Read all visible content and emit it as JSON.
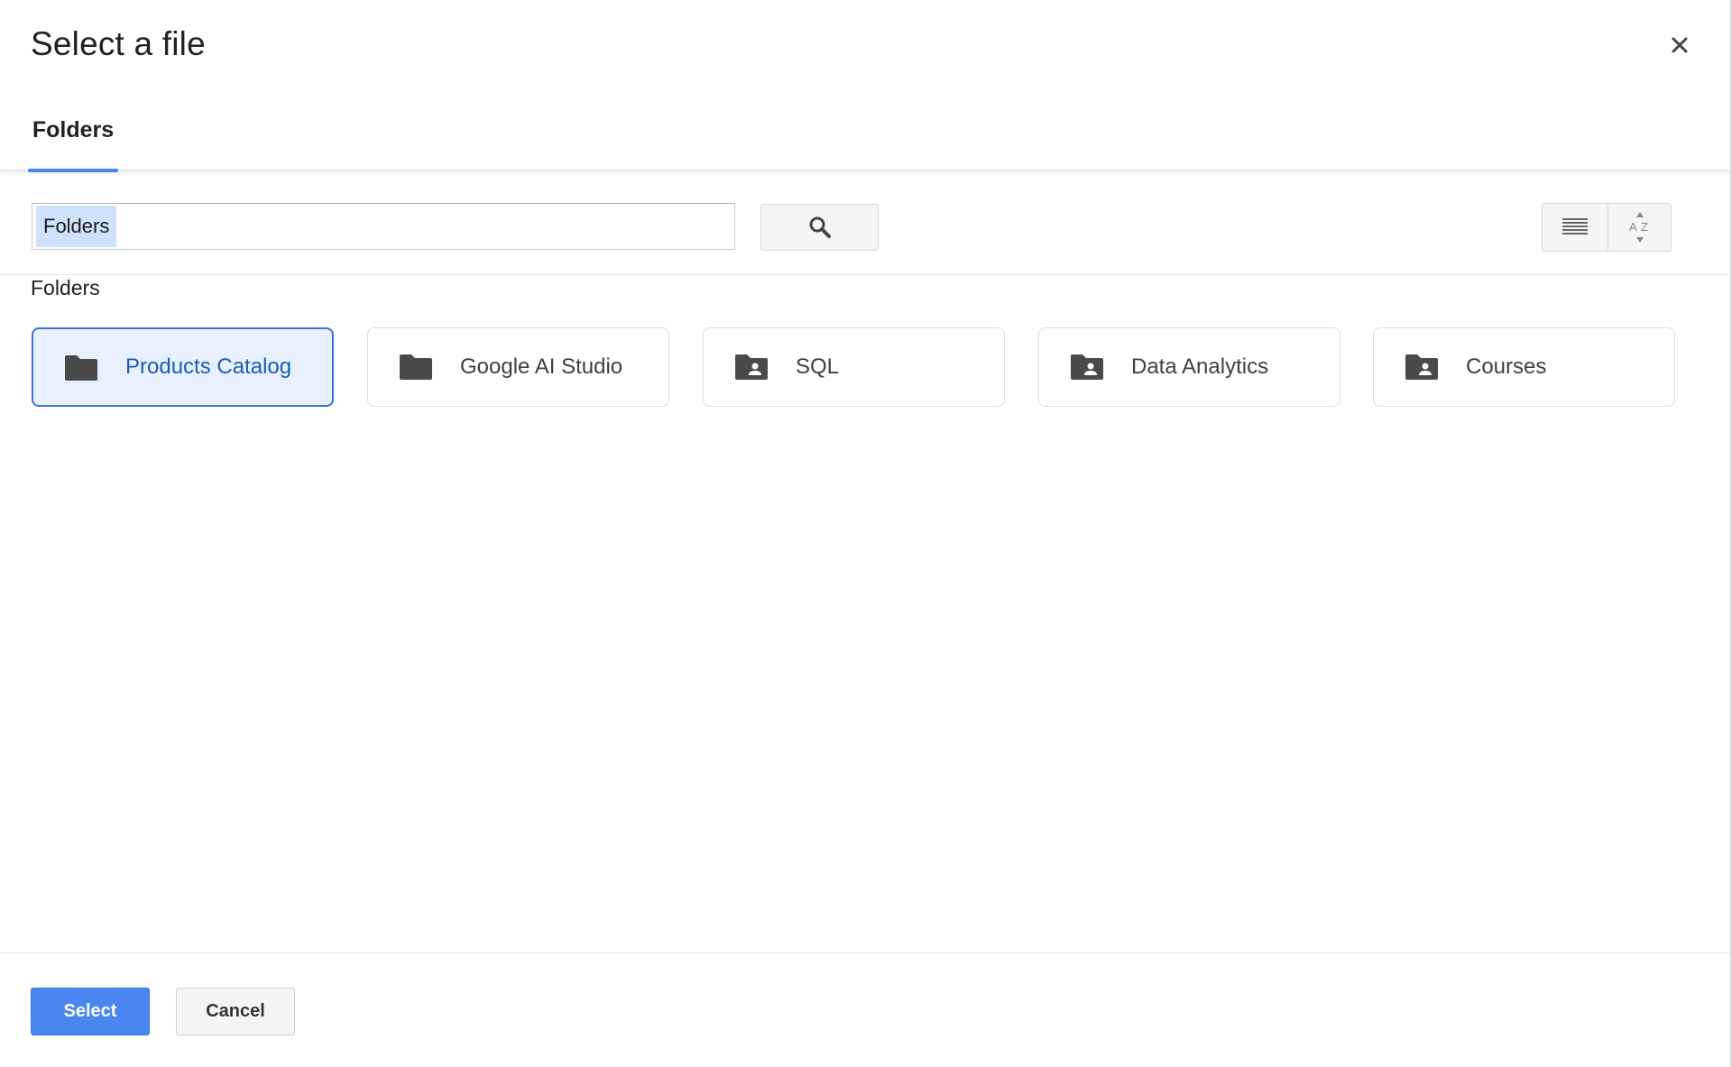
{
  "dialog": {
    "title": "Select a file",
    "close_icon": "close-icon"
  },
  "tabs": [
    {
      "label": "Folders",
      "active": true
    }
  ],
  "toolbar": {
    "search_value": "Folders",
    "search_icon": "search-icon",
    "view_icon": "list-view-icon",
    "sort_icon": "sort-az-icon"
  },
  "content": {
    "section_label": "Folders",
    "folders": [
      {
        "name": "Products Catalog",
        "type": "folder",
        "selected": true
      },
      {
        "name": "Google AI Studio",
        "type": "folder",
        "selected": false
      },
      {
        "name": "SQL",
        "type": "shared-folder",
        "selected": false
      },
      {
        "name": "Data Analytics",
        "type": "shared-folder",
        "selected": false
      },
      {
        "name": "Courses",
        "type": "shared-folder",
        "selected": false
      }
    ]
  },
  "footer": {
    "select_label": "Select",
    "cancel_label": "Cancel"
  },
  "colors": {
    "accent": "#4285f4",
    "selected_bg": "#e8f0fe",
    "selected_text": "#1a5cb8",
    "primary_button": "#4a86f0"
  }
}
